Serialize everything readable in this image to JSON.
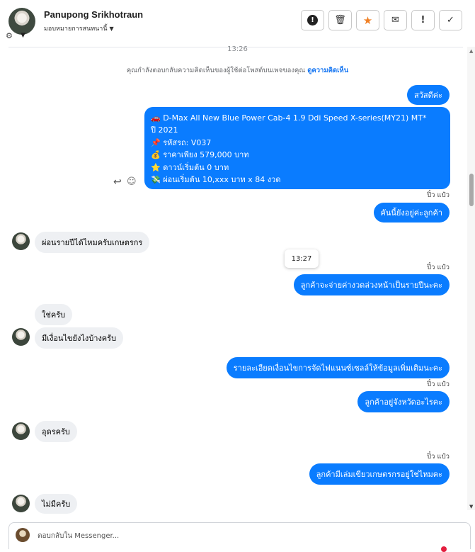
{
  "header": {
    "name": "Panupong Srikhotraun",
    "assign_label": "มอบหมายการสนทนานี้",
    "actions": [
      "alert-icon",
      "trash-icon",
      "star-icon",
      "mail-icon",
      "exclaim-icon",
      "check-icon"
    ]
  },
  "chat": {
    "top_time": "13:26",
    "notice_text": "คุณกำลังตอบกลับความคิดเห็นของผู้ใช้ต่อโพสต์บนเพจของคุณ ",
    "notice_link": "ดูความคิดเห็น",
    "messages": {
      "m1": "สวัสดีค่ะ",
      "card": {
        "line1": "🚗 D-Max All New Blue Power Cab-4 1.9 Ddi Speed X-series(MY21) MT*",
        "line2": "ปี 2021",
        "line3": "📌 รหัสรถ: V037",
        "line4": "💰 ราคาเพียง 579,000 บาท",
        "line5": "⭐ ดาวน์เริ่มต้น 0 บาท",
        "line6": "💸 ผ่อนเริ่มต้น 10,xxx บาท x 84 งวด"
      },
      "seen1": "ปิ๋ว แป๋ว",
      "m2": "คันนี้ยังอยู่ค่ะลูกค้า",
      "m3": "ผ่อนรายปีได้ไหมครับเกษตรกร",
      "time2": "13:27",
      "seen2": "ปิ๋ว แป๋ว",
      "m4": "ลูกค้าจะจ่ายค่างวดล่วงหน้าเป็นรายปีนะคะ",
      "m5": "ใช่ครับ",
      "m6": "มีเงื่อนไขยังไงบ้างครับ",
      "m7": "รายละเอียดเงื่อนไขการจัดไฟแนนซ์เซลล์ให้ข้อมูลเพิ่มเติมนะคะ",
      "seen3": "ปิ๋ว แป๋ว",
      "m8": "ลูกค้าอยู่จังหวัดอะไรคะ",
      "m9": "อุดรครับ",
      "seen4": "ปิ๋ว แป๋ว",
      "m10": "ลูกค้ามีเล่มเขียวเกษตรกรอยู่ใช่ไหมคะ",
      "m11": "ไม่มีครับ"
    }
  },
  "composer": {
    "placeholder": "ตอบกลับใน Messenger..."
  },
  "colors": {
    "outgoing": "#0a7cff",
    "incoming": "#eef0f3",
    "accent_star": "#f07f23"
  }
}
